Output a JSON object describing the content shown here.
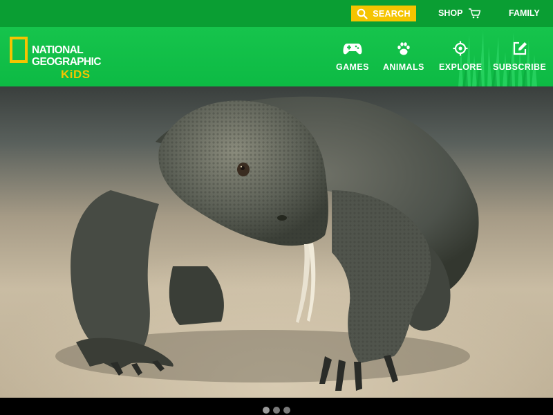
{
  "topbar": {
    "search_label": "SEARCH",
    "search_icon": "search-icon",
    "shop_label": "SHOP",
    "shop_icon": "cart-icon",
    "family_label": "FAMILY"
  },
  "logo": {
    "line1": "NATIONAL",
    "line2": "GEOGRAPHIC",
    "line3": "KiDS"
  },
  "nav": {
    "items": [
      {
        "label": "GAMES",
        "icon": "gamepad-icon"
      },
      {
        "label": "ANIMALS",
        "icon": "paw-icon"
      },
      {
        "label": "EXPLORE",
        "icon": "target-icon"
      },
      {
        "label": "SUBSCRIBE",
        "icon": "edit-icon"
      }
    ]
  },
  "hero": {
    "image_subject": "komodo-dragon"
  },
  "carousel": {
    "slide_count": 3,
    "active_index": 0
  },
  "colors": {
    "topbar": "#0a9e33",
    "navbar": "#12c046",
    "accent_yellow": "#f5c400"
  }
}
